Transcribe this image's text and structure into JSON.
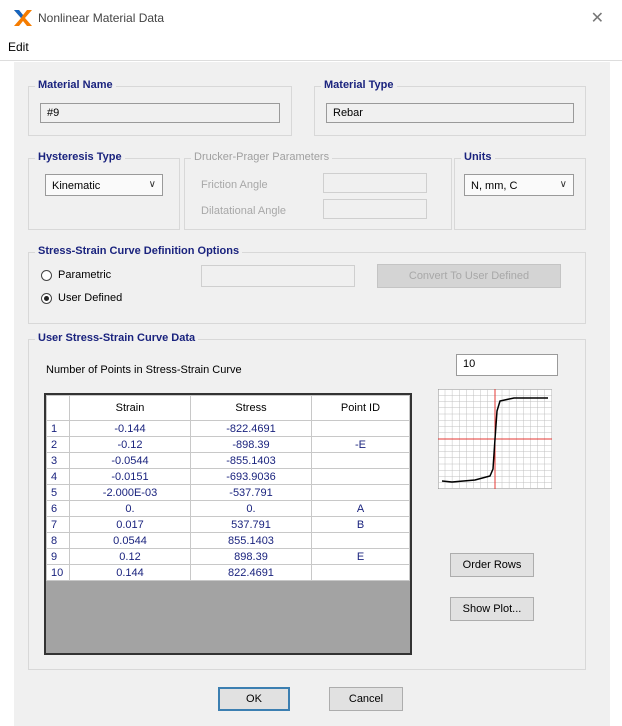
{
  "window": {
    "title": "Nonlinear Material Data",
    "close_glyph": "✕"
  },
  "menu": {
    "edit": "Edit"
  },
  "material_name": {
    "label": "Material Name",
    "value": "#9"
  },
  "material_type": {
    "label": "Material Type",
    "value": "Rebar"
  },
  "hysteresis": {
    "label": "Hysteresis Type",
    "value": "Kinematic"
  },
  "drucker": {
    "label": "Drucker-Prager Parameters",
    "friction_label": "Friction Angle",
    "dilatational_label": "Dilatational Angle",
    "friction_value": "",
    "dilatational_value": ""
  },
  "units": {
    "label": "Units",
    "value": "N, mm, C"
  },
  "curve_options": {
    "label": "Stress-Strain Curve Definition Options",
    "parametric": "Parametric",
    "user_defined": "User Defined",
    "selected": "user_defined",
    "param_value": "",
    "convert_label": "Convert To User Defined"
  },
  "user_curve": {
    "label": "User Stress-Strain Curve Data",
    "npoints_label": "Number of Points in Stress-Strain Curve",
    "npoints_value": "10"
  },
  "table": {
    "headers": [
      "",
      "Strain",
      "Stress",
      "Point ID"
    ],
    "rows": [
      [
        "1",
        "-0.144",
        "-822.4691",
        ""
      ],
      [
        "2",
        "-0.12",
        "-898.39",
        "-E"
      ],
      [
        "3",
        "-0.0544",
        "-855.1403",
        ""
      ],
      [
        "4",
        "-0.0151",
        "-693.9036",
        ""
      ],
      [
        "5",
        "-2.000E-03",
        "-537.791",
        ""
      ],
      [
        "6",
        "0.",
        "0.",
        "A"
      ],
      [
        "7",
        "0.017",
        "537.791",
        "B"
      ],
      [
        "8",
        "0.0544",
        "855.1403",
        ""
      ],
      [
        "9",
        "0.12",
        "898.39",
        "E"
      ],
      [
        "10",
        "0.144",
        "822.4691",
        ""
      ]
    ]
  },
  "buttons": {
    "order_rows": "Order Rows",
    "show_plot": "Show Plot...",
    "ok": "OK",
    "cancel": "Cancel"
  },
  "colors": {
    "accent": "#1a237e",
    "icon_orange": "#f57c00",
    "curve_red": "#e53935"
  }
}
